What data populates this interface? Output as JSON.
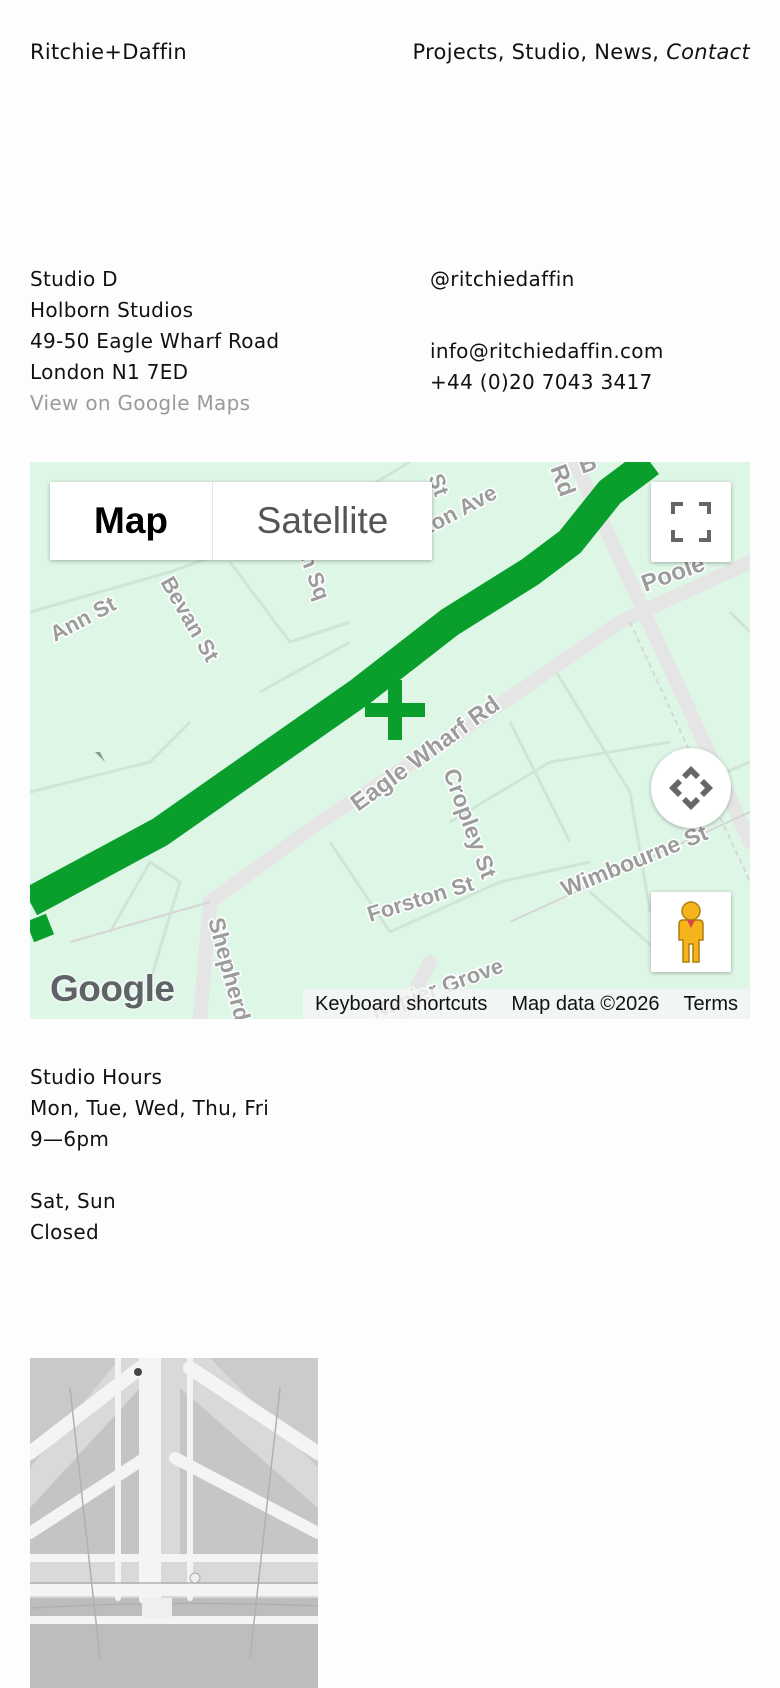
{
  "header": {
    "brand": "Ritchie+Daffin",
    "nav": [
      {
        "label": "Projects",
        "sep": ", "
      },
      {
        "label": "Studio",
        "sep": ", "
      },
      {
        "label": "News",
        "sep": ", "
      },
      {
        "label": "Contact",
        "sep": ""
      }
    ]
  },
  "address": {
    "line1": "Studio D",
    "line2": "Holborn Studios",
    "line3": "49-50 Eagle Wharf Road",
    "line4": "London N1 7ED",
    "map_link": "View on Google Maps"
  },
  "contact": {
    "instagram": "@ritchiedaffin",
    "email": "info@ritchiedaffin.com",
    "phone": "+44 (0)20 7043 3417"
  },
  "map": {
    "tab_map": "Map",
    "tab_satellite": "Satellite",
    "logo": "Google",
    "shortcuts": "Keyboard shortcuts",
    "map_data": "Map data ©2026",
    "terms": "Terms",
    "streets": {
      "ann": "Ann St",
      "bevan": "Bevan St",
      "sq": "n Sq",
      "ave": "ngton Ave",
      "st_top": "St",
      "rd_top": "Rd",
      "b": "B",
      "poole": "Poole",
      "eagle": "Eagle Wharf Rd",
      "cropley": "Cropley St",
      "forston": "Forston St",
      "wimbourne": "Wimbourne St",
      "shepherd": "Shepherd",
      "napier": "Napier Grove"
    },
    "colors": {
      "land": "#def6e6",
      "canal": "#0a9e2c",
      "road": "#e7e7e7"
    }
  },
  "hours": {
    "title": "Studio Hours",
    "weekdays": "Mon, Tue, Wed, Thu, Fri",
    "weekday_hours": "9—6pm",
    "weekend": "Sat, Sun",
    "weekend_hours": "Closed"
  }
}
